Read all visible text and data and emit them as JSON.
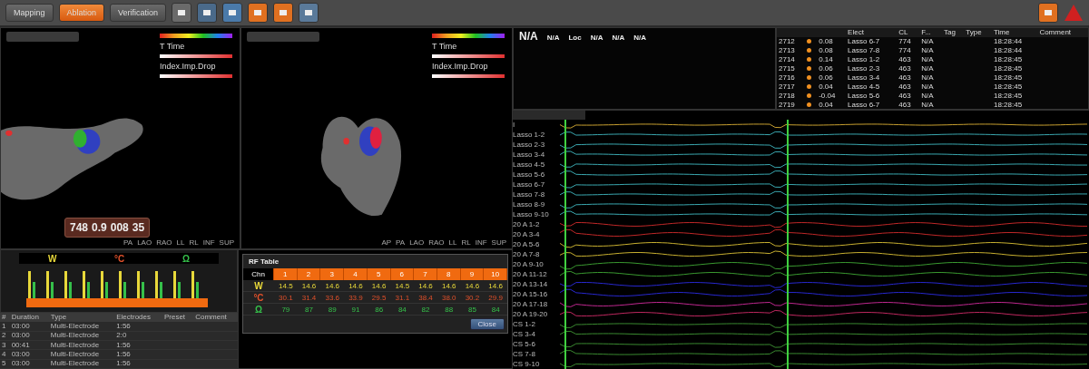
{
  "toolbar": {
    "tabs": [
      {
        "label": "Mapping",
        "selected": false
      },
      {
        "label": "Ablation",
        "selected": true
      },
      {
        "label": "Verification",
        "selected": false
      }
    ]
  },
  "maps": [
    {
      "legend": [
        "T Time",
        "Index.Imp.Drop"
      ],
      "readout": [
        "748",
        "0.9",
        "008",
        "35"
      ],
      "views": [
        "PA",
        "LAO",
        "RAO",
        "LL",
        "RL",
        "INF",
        "SUP"
      ]
    },
    {
      "legend": [
        "T Time",
        "Index.Imp.Drop"
      ],
      "views": [
        "AP",
        "PA",
        "LAO",
        "RAO",
        "LL",
        "RL",
        "INF",
        "SUP"
      ]
    }
  ],
  "power_chart": {
    "legend": [
      {
        "label": "W",
        "color": "#e8d83a"
      },
      {
        "label": "°C",
        "color": "#e0502a"
      },
      {
        "label": "Ω",
        "color": "#35c04a"
      }
    ]
  },
  "ablation_list": {
    "columns": [
      "#",
      "Duration",
      "Type",
      "Electrodes",
      "Preset",
      "Comment"
    ],
    "rows": [
      [
        "1",
        "03:00",
        "Multi-Electrode",
        "1:56"
      ],
      [
        "2",
        "03:00",
        "Multi-Electrode",
        "2:0"
      ],
      [
        "3",
        "00:41",
        "Multi-Electrode",
        "1:56"
      ],
      [
        "4",
        "03:00",
        "Multi-Electrode",
        "1:56"
      ],
      [
        "5",
        "03:00",
        "Multi-Electrode",
        "1:56"
      ]
    ]
  },
  "rf_table": {
    "title": "RF Table",
    "header": "Chn",
    "channels": [
      "1",
      "2",
      "3",
      "4",
      "5",
      "6",
      "7",
      "8",
      "9",
      "10"
    ],
    "rows": [
      {
        "label": "W",
        "color": "#e8d83a",
        "values": [
          "14.5",
          "14.6",
          "14.6",
          "14.6",
          "14.6",
          "14.5",
          "14.6",
          "14.6",
          "14.6",
          "14.6"
        ]
      },
      {
        "label": "°C",
        "color": "#e0502a",
        "values": [
          "30.1",
          "31.4",
          "33.6",
          "33.9",
          "29.5",
          "31.1",
          "38.4",
          "38.0",
          "30.2",
          "29.9"
        ]
      },
      {
        "label": "Ω",
        "color": "#35c04a",
        "values": [
          "79",
          "87",
          "89",
          "91",
          "86",
          "84",
          "82",
          "88",
          "85",
          "84"
        ]
      }
    ],
    "close": "Close"
  },
  "mapping_info": {
    "values": [
      "N/A",
      "N/A",
      "Loc",
      "N/A",
      "N/A",
      "N/A"
    ]
  },
  "annotations": {
    "columns": [
      "Elect",
      "CL",
      "F...",
      "Tag",
      "Type",
      "Time",
      "Comment"
    ],
    "rows": [
      {
        "id": "2712",
        "value": "0.08",
        "electrode": "Lasso 6-7",
        "cl": "774",
        "f": "N/A",
        "time": "18:28:44"
      },
      {
        "id": "2713",
        "value": "0.08",
        "electrode": "Lasso 7-8",
        "cl": "774",
        "f": "N/A",
        "time": "18:28:44"
      },
      {
        "id": "2714",
        "value": "0.14",
        "electrode": "Lasso 1-2",
        "cl": "463",
        "f": "N/A",
        "time": "18:28:45"
      },
      {
        "id": "2715",
        "value": "0.06",
        "electrode": "Lasso 2-3",
        "cl": "463",
        "f": "N/A",
        "time": "18:28:45"
      },
      {
        "id": "2716",
        "value": "0.06",
        "electrode": "Lasso 3-4",
        "cl": "463",
        "f": "N/A",
        "time": "18:28:45"
      },
      {
        "id": "2717",
        "value": "0.04",
        "electrode": "Lasso 4-5",
        "cl": "463",
        "f": "N/A",
        "time": "18:28:45"
      },
      {
        "id": "2718",
        "value": "-0.04",
        "electrode": "Lasso 5-6",
        "cl": "463",
        "f": "N/A",
        "time": "18:28:45"
      },
      {
        "id": "2719",
        "value": "0.04",
        "electrode": "Lasso 6-7",
        "cl": "463",
        "f": "N/A",
        "time": "18:28:45"
      }
    ]
  },
  "signals": {
    "channels": [
      {
        "label": "I",
        "color": "#c8a030"
      },
      {
        "label": "Lasso 1-2",
        "color": "#3aa8b0"
      },
      {
        "label": "Lasso 2-3",
        "color": "#3aa8b0"
      },
      {
        "label": "Lasso 3-4",
        "color": "#3aa8b0"
      },
      {
        "label": "Lasso 4-5",
        "color": "#3aa8b0"
      },
      {
        "label": "Lasso 5-6",
        "color": "#3aa8b0"
      },
      {
        "label": "Lasso 6-7",
        "color": "#3aa8b0"
      },
      {
        "label": "Lasso 7-8",
        "color": "#3aa8b0"
      },
      {
        "label": "Lasso 8-9",
        "color": "#3aa8b0"
      },
      {
        "label": "Lasso 9-10",
        "color": "#3aa8b0"
      },
      {
        "label": "20 A 1-2",
        "color": "#c02828"
      },
      {
        "label": "20 A 3-4",
        "color": "#c02828"
      },
      {
        "label": "20 A 5-6",
        "color": "#c8b030"
      },
      {
        "label": "20 A 7-8",
        "color": "#c8b030"
      },
      {
        "label": "20 A 9-10",
        "color": "#3a9a30"
      },
      {
        "label": "20 A 11-12",
        "color": "#3a9a30"
      },
      {
        "label": "20 A 13-14",
        "color": "#2828d0"
      },
      {
        "label": "20 A 15-16",
        "color": "#2828d0"
      },
      {
        "label": "20 A 17-18",
        "color": "#c02890"
      },
      {
        "label": "20 A 19-20",
        "color": "#c02860"
      },
      {
        "label": "CS 1-2",
        "color": "#3a8a30"
      },
      {
        "label": "CS 3-4",
        "color": "#3a8a30"
      },
      {
        "label": "CS 5-6",
        "color": "#3a8a30"
      },
      {
        "label": "CS 7-8",
        "color": "#3a8a30"
      },
      {
        "label": "CS 9-10",
        "color": "#3a8a30"
      }
    ]
  }
}
